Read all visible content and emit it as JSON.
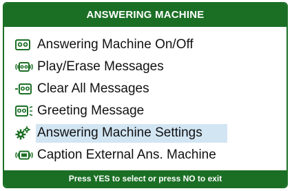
{
  "header": {
    "title": "ANSWERING MACHINE"
  },
  "menu": {
    "items": [
      {
        "label": "Answering Machine On/Off",
        "icon": "tape-icon",
        "selected": false
      },
      {
        "label": "Play/Erase Messages",
        "icon": "play-tape-icon",
        "selected": false
      },
      {
        "label": "Clear All Messages",
        "icon": "clear-tape-icon",
        "selected": false
      },
      {
        "label": "Greeting Message",
        "icon": "greeting-tape-icon",
        "selected": false
      },
      {
        "label": "Answering Machine Settings",
        "icon": "gears-icon",
        "selected": true
      },
      {
        "label": "Caption External Ans. Machine",
        "icon": "external-machine-icon",
        "selected": false
      }
    ]
  },
  "footer": {
    "hint": "Press YES to select or press NO to exit"
  },
  "colors": {
    "accent": "#1b6f25",
    "selection": "#d2e5f3",
    "text": "#111111"
  }
}
